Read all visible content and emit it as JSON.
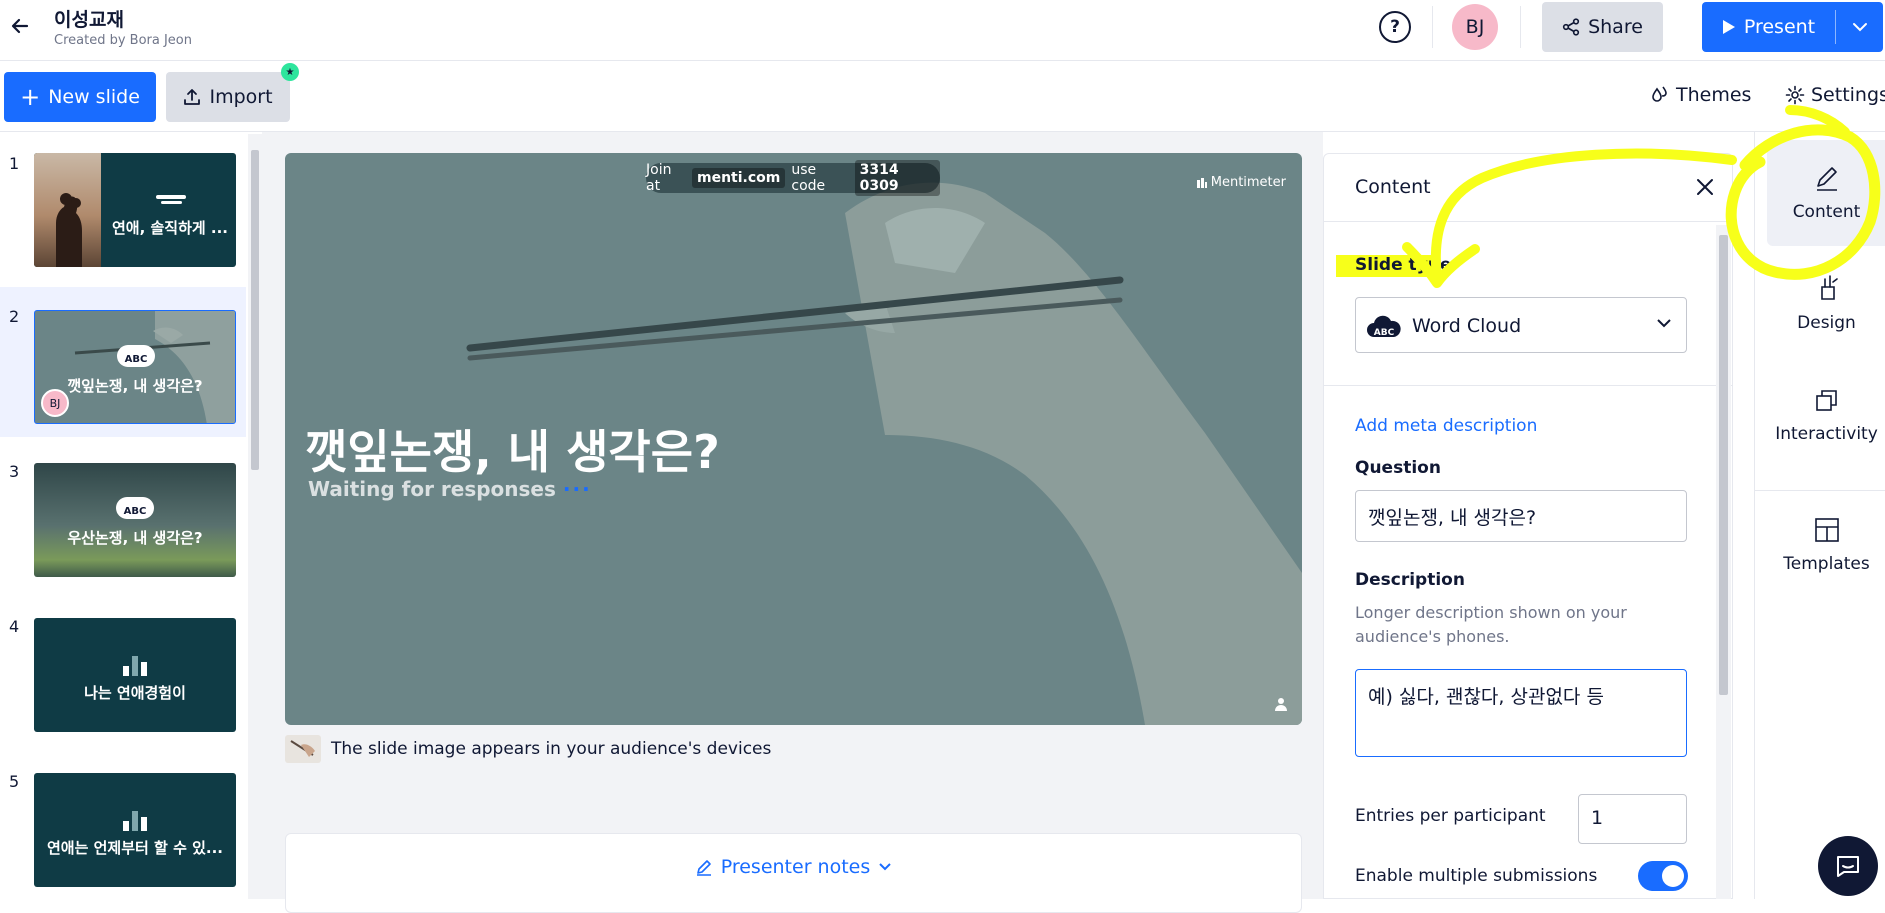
{
  "header": {
    "title": "이성교재",
    "subtitle": "Created by Bora Jeon",
    "avatar_initials": "BJ",
    "share_label": "Share",
    "present_label": "Present"
  },
  "toolbar": {
    "new_slide_label": "New slide",
    "import_label": "Import",
    "themes_label": "Themes",
    "settings_label": "Settings"
  },
  "slides": [
    {
      "number": "1",
      "title": "연애, 솔직하게 ...",
      "bg": "#0f3b45"
    },
    {
      "number": "2",
      "title": "깻잎논쟁, 내 생각은?",
      "bg": "#6b8587",
      "icon": "ABC",
      "avatar": "BJ",
      "selected": true
    },
    {
      "number": "3",
      "title": "우산논쟁, 내 생각은?",
      "bg": "#4e6467",
      "icon": "ABC"
    },
    {
      "number": "4",
      "title": "나는 연애경험이",
      "bg": "#0f3b45"
    },
    {
      "number": "5",
      "title": "연애는 언제부터 할 수 있...",
      "bg": "#0f3b45"
    }
  ],
  "canvas": {
    "join_prefix": "Join at",
    "join_url": "menti.com",
    "join_mid": "use code",
    "join_code": "3314 0309",
    "brand": "Mentimeter",
    "question": "깻잎논쟁, 내 생각은?",
    "waiting": "Waiting for responses",
    "caption": "The slide image appears in your audience's devices",
    "presenter_notes": "Presenter notes"
  },
  "content_panel": {
    "title": "Content",
    "slide_type_label": "Slide type",
    "slide_type_value": "Word Cloud",
    "slide_type_icon": "ABC",
    "meta_link": "Add meta description",
    "question_label": "Question",
    "question_value": "깻잎논쟁, 내 생각은?",
    "description_label": "Description",
    "description_helper": "Longer description shown on your audience's phones.",
    "description_value": "예) 싫다, 괜찮다, 상관없다 등",
    "entries_label": "Entries per participant",
    "entries_value": "1",
    "multiple_label": "Enable multiple submissions",
    "multiple_enabled": true
  },
  "rail": {
    "content": "Content",
    "design": "Design",
    "interactivity": "Interactivity",
    "templates": "Templates"
  },
  "colors": {
    "accent": "#196cff",
    "annotation": "#f7ff1a",
    "dark_slide": "#0f3b45"
  }
}
